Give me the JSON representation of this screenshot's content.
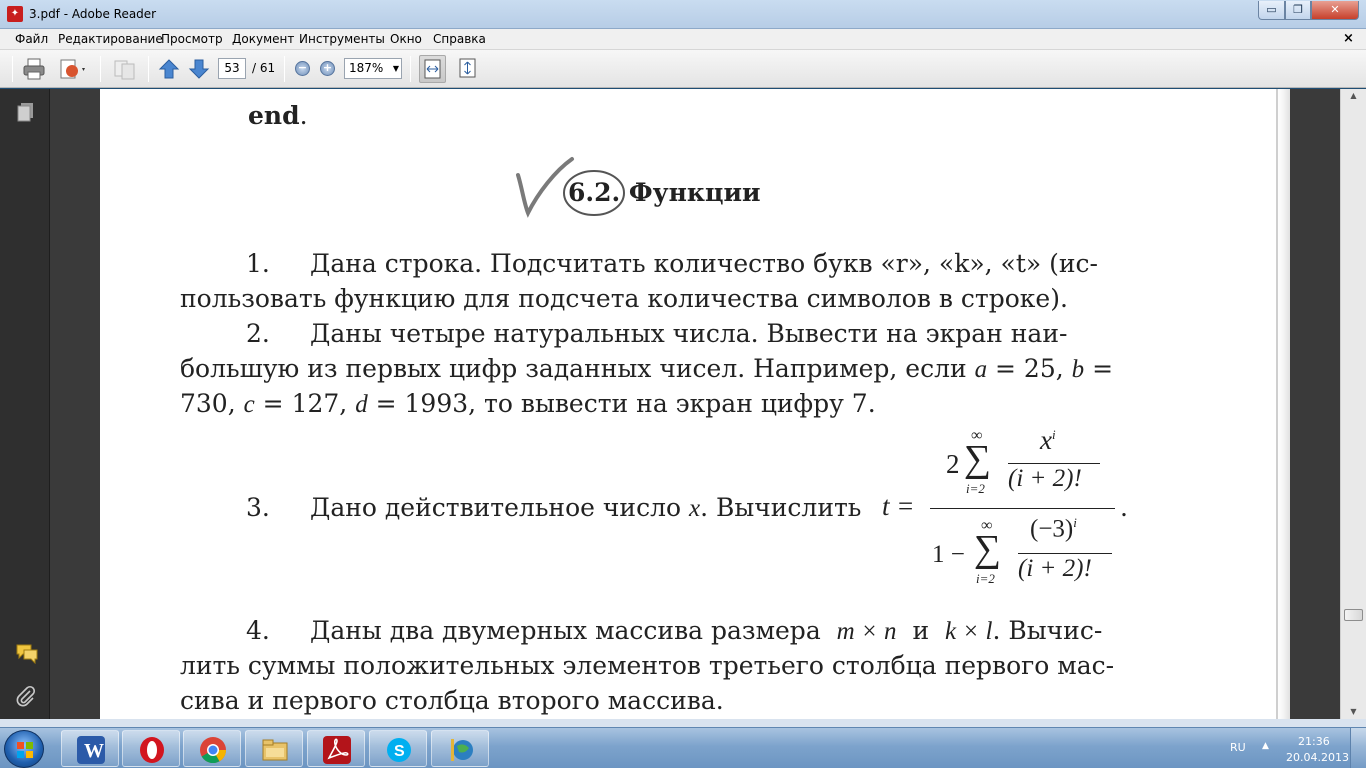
{
  "window": {
    "title": "3.pdf - Adobe Reader",
    "buttons": {
      "minimize": "▭",
      "maximize": "❐",
      "close": "✕"
    }
  },
  "menu": {
    "items": [
      "Файл",
      "Редактирование",
      "Просмотр",
      "Документ",
      "Инструменты",
      "Окно",
      "Справка"
    ],
    "doc_close": "×"
  },
  "toolbar": {
    "current_page": "53",
    "total_pages": "/ 61",
    "zoom": "187%",
    "icons": [
      "print-icon",
      "create-pdf-icon",
      "collaborate-icon",
      "previous-page-icon",
      "next-page-icon",
      "zoom-out-icon",
      "zoom-in-icon",
      "fit-width-icon",
      "fit-page-icon"
    ]
  },
  "nav_panel": {
    "icons": [
      "pages-icon",
      "comments-icon",
      "attachments-icon"
    ]
  },
  "document": {
    "end_word": "end",
    "end_dot": ".",
    "section_title": "6.2. Функции",
    "problems": {
      "p1": {
        "number": "1.",
        "line1": "Дана строка. Подсчитать количество букв «r», «k», «t» (ис-",
        "line2": "пользовать функцию для подсчета количества символов в строке)."
      },
      "p2": {
        "number": "2.",
        "line1": "Даны четыре натуральных числа. Вывести на экран наи-",
        "line2_a": "большую из первых цифр заданных чисел. Например, если ",
        "var_a": "a",
        "line2_b": " = 25, ",
        "var_b": "b",
        "line2_c": " =",
        "line3_a": "730, ",
        "var_c": "c",
        "line3_b": " = 127, ",
        "var_d": "d",
        "line3_c": " = 1993, то вывести на экран цифру 7."
      },
      "p3": {
        "number": "3.",
        "text": "Дано действительное число ",
        "var_x": "x",
        "text2": ". Вычислить",
        "t_eq": "t =",
        "formula": {
          "num_coef": "2",
          "sigma": "∑",
          "upper": "∞",
          "lower": "i=2",
          "num_numer": "x",
          "num_exp": "i",
          "num_denom": "(i + 2)!",
          "den_one": "1 −",
          "den_numer": "(−3)",
          "den_exp": "i",
          "den_denom": "(i + 2)!"
        },
        "end": "."
      },
      "p4": {
        "number": "4.",
        "line1_a": "Даны два двумерных массива размера",
        "dim1": "m × n",
        "and": "и",
        "dim2": "k × l",
        "line1_b": ". Вычис-",
        "line2": "лить суммы положительных элементов третьего столбца первого мас-",
        "line3": "сива и первого столбца второго массива."
      }
    }
  },
  "taskbar": {
    "apps": [
      "word-icon",
      "opera-icon",
      "chrome-icon",
      "explorer-icon",
      "acrobat-icon",
      "skype-icon",
      "network-icon"
    ],
    "language": "RU",
    "tray_arrow": "▲",
    "time": "21:36",
    "date": "20.04.2013"
  }
}
